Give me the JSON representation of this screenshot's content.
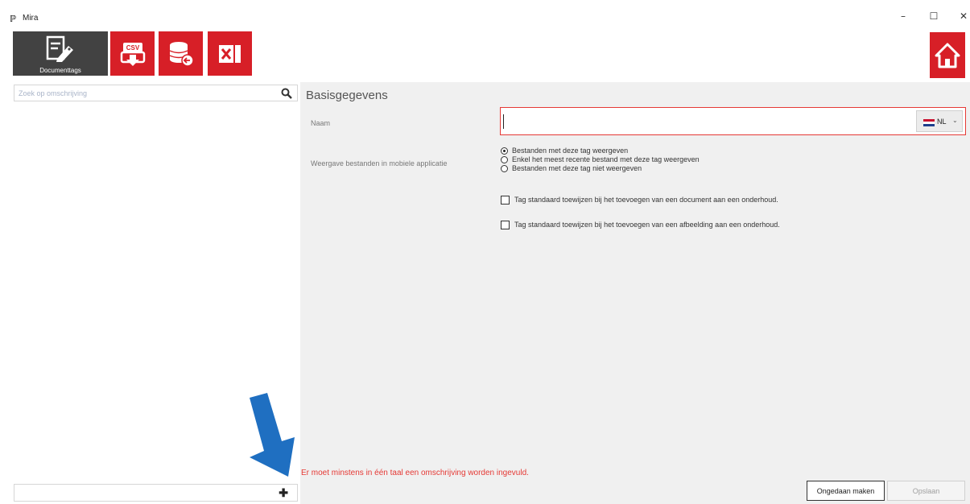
{
  "window": {
    "title": "Mira",
    "app_icon_glyph": "ℙ",
    "minimize_glyph": "–",
    "maximize_glyph": "☐",
    "close_glyph": "✕"
  },
  "toolbar": {
    "documenttags_label": "Documenttags",
    "icons": [
      "document-tag-icon",
      "csv-export-icon",
      "database-import-icon",
      "excel-icon",
      "home-icon"
    ],
    "accent_color": "#d71f27",
    "active_bg": "#424242"
  },
  "sidebar": {
    "search_placeholder": "Zoek op omschrijving",
    "add_glyph": "✚"
  },
  "form": {
    "section_title": "Basisgegevens",
    "naam_label": "Naam",
    "naam_value": "",
    "language": "NL",
    "language_chevron": "⌄",
    "weergave_label": "Weergave bestanden in mobiele applicatie",
    "radio_options": [
      {
        "label": "Bestanden met deze tag weergeven",
        "selected": true
      },
      {
        "label": "Enkel het meest recente bestand met deze tag weergeven",
        "selected": false
      },
      {
        "label": "Bestanden met deze tag niet weergeven",
        "selected": false
      }
    ],
    "checkbox_document": {
      "label": "Tag standaard toewijzen bij het toevoegen van een document aan een onderhoud.",
      "checked": false
    },
    "checkbox_afbeelding": {
      "label": "Tag standaard toewijzen bij het toevoegen van een afbeelding aan een onderhoud.",
      "checked": false
    }
  },
  "footer": {
    "error_message": "Er moet minstens in één taal een omschrijving worden ingevuld.",
    "undo_label": "Ongedaan maken",
    "save_label": "Opslaan"
  },
  "colors": {
    "error": "#e53935",
    "arrow": "#1f6fc1",
    "panel_bg": "#f0f0f0"
  }
}
